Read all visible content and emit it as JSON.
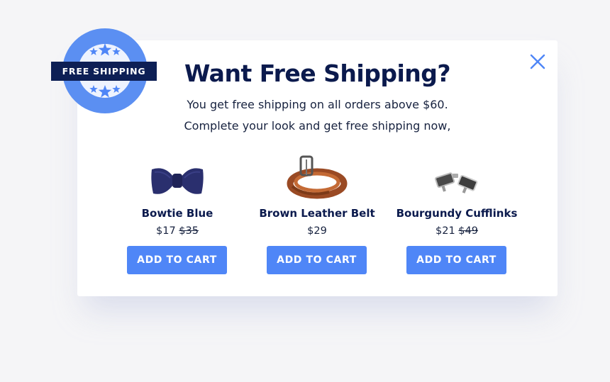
{
  "badge": {
    "text": "FREE SHIPPING"
  },
  "modal": {
    "title": "Want Free Shipping?",
    "subtitle_line1": "You get free shipping on all orders above $60.",
    "subtitle_line2": "Complete your look and get free shipping now,"
  },
  "products": [
    {
      "name": "Bowtie Blue",
      "price": "$17",
      "old_price": "$35",
      "button_label": "ADD TO CART",
      "image": "bowtie-image"
    },
    {
      "name": "Brown Leather Belt",
      "price": "$29",
      "old_price": "",
      "button_label": "ADD TO CART",
      "image": "belt-image"
    },
    {
      "name": "Bourgundy Cufflinks",
      "price": "$21",
      "old_price": "$49",
      "button_label": "ADD TO CART",
      "image": "cufflinks-image"
    }
  ],
  "icons": {
    "close": "close-icon",
    "badge": "free-shipping-badge-icon",
    "stars": "star-icon"
  },
  "colors": {
    "accent": "#4f86f7",
    "navy": "#0b1a4d",
    "badge_ring": "#5b8ff2",
    "badge_ribbon": "#0d1f55",
    "background": "#f5f5f7"
  }
}
